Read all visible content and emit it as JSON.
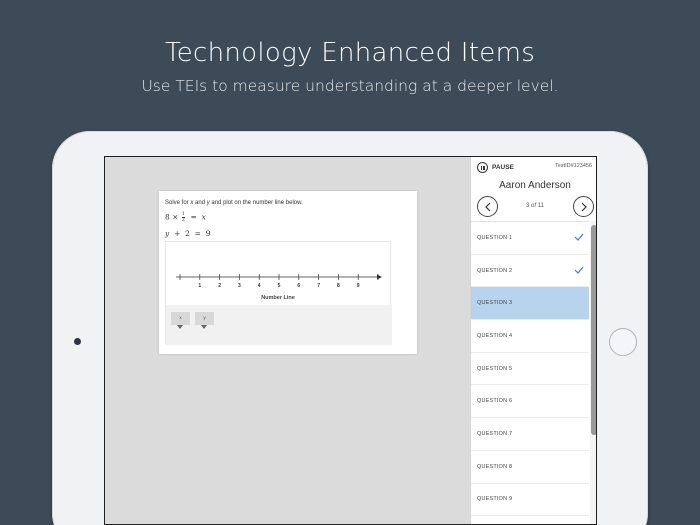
{
  "hero": {
    "title": "Technology Enhanced Items",
    "subtitle": "Use TEIs to measure understanding at a deeper level."
  },
  "question": {
    "prompt_parts": [
      "Solve for ",
      "x",
      " and ",
      "y",
      " and plot on the number line below."
    ],
    "eq1": {
      "coef": "8",
      "op": "×",
      "num": "1",
      "den": "2",
      "eq": "=",
      "var": "x"
    },
    "eq2": {
      "lhs": "y",
      "op": "+",
      "val": "2",
      "eq": "=",
      "rhs": "9"
    },
    "number_line": {
      "label": "Number Line",
      "ticks": [
        "1",
        "2",
        "3",
        "4",
        "5",
        "6",
        "7",
        "8",
        "9"
      ]
    },
    "tokens": [
      "x",
      "y"
    ]
  },
  "sidebar": {
    "pause_label": "PAUSE",
    "test_id": "TestID#123456",
    "student_name": "Aaron Anderson",
    "progress": {
      "current": "3",
      "of": "of",
      "total": "11"
    },
    "questions": [
      {
        "label": "QUESTION 1",
        "answered": true
      },
      {
        "label": "QUESTION 2",
        "answered": true
      },
      {
        "label": "QUESTION 3",
        "answered": false,
        "active": true
      },
      {
        "label": "QUESTION 4",
        "answered": false
      },
      {
        "label": "QUESTION 5",
        "answered": false
      },
      {
        "label": "QUESTION 6",
        "answered": false
      },
      {
        "label": "QUESTION 7",
        "answered": false
      },
      {
        "label": "QUESTION 8",
        "answered": false
      },
      {
        "label": "QUESTION 9",
        "answered": false
      }
    ]
  },
  "colors": {
    "background": "#3d4b58",
    "active_question": "#b8d3ee",
    "check": "#3a7fd0"
  }
}
